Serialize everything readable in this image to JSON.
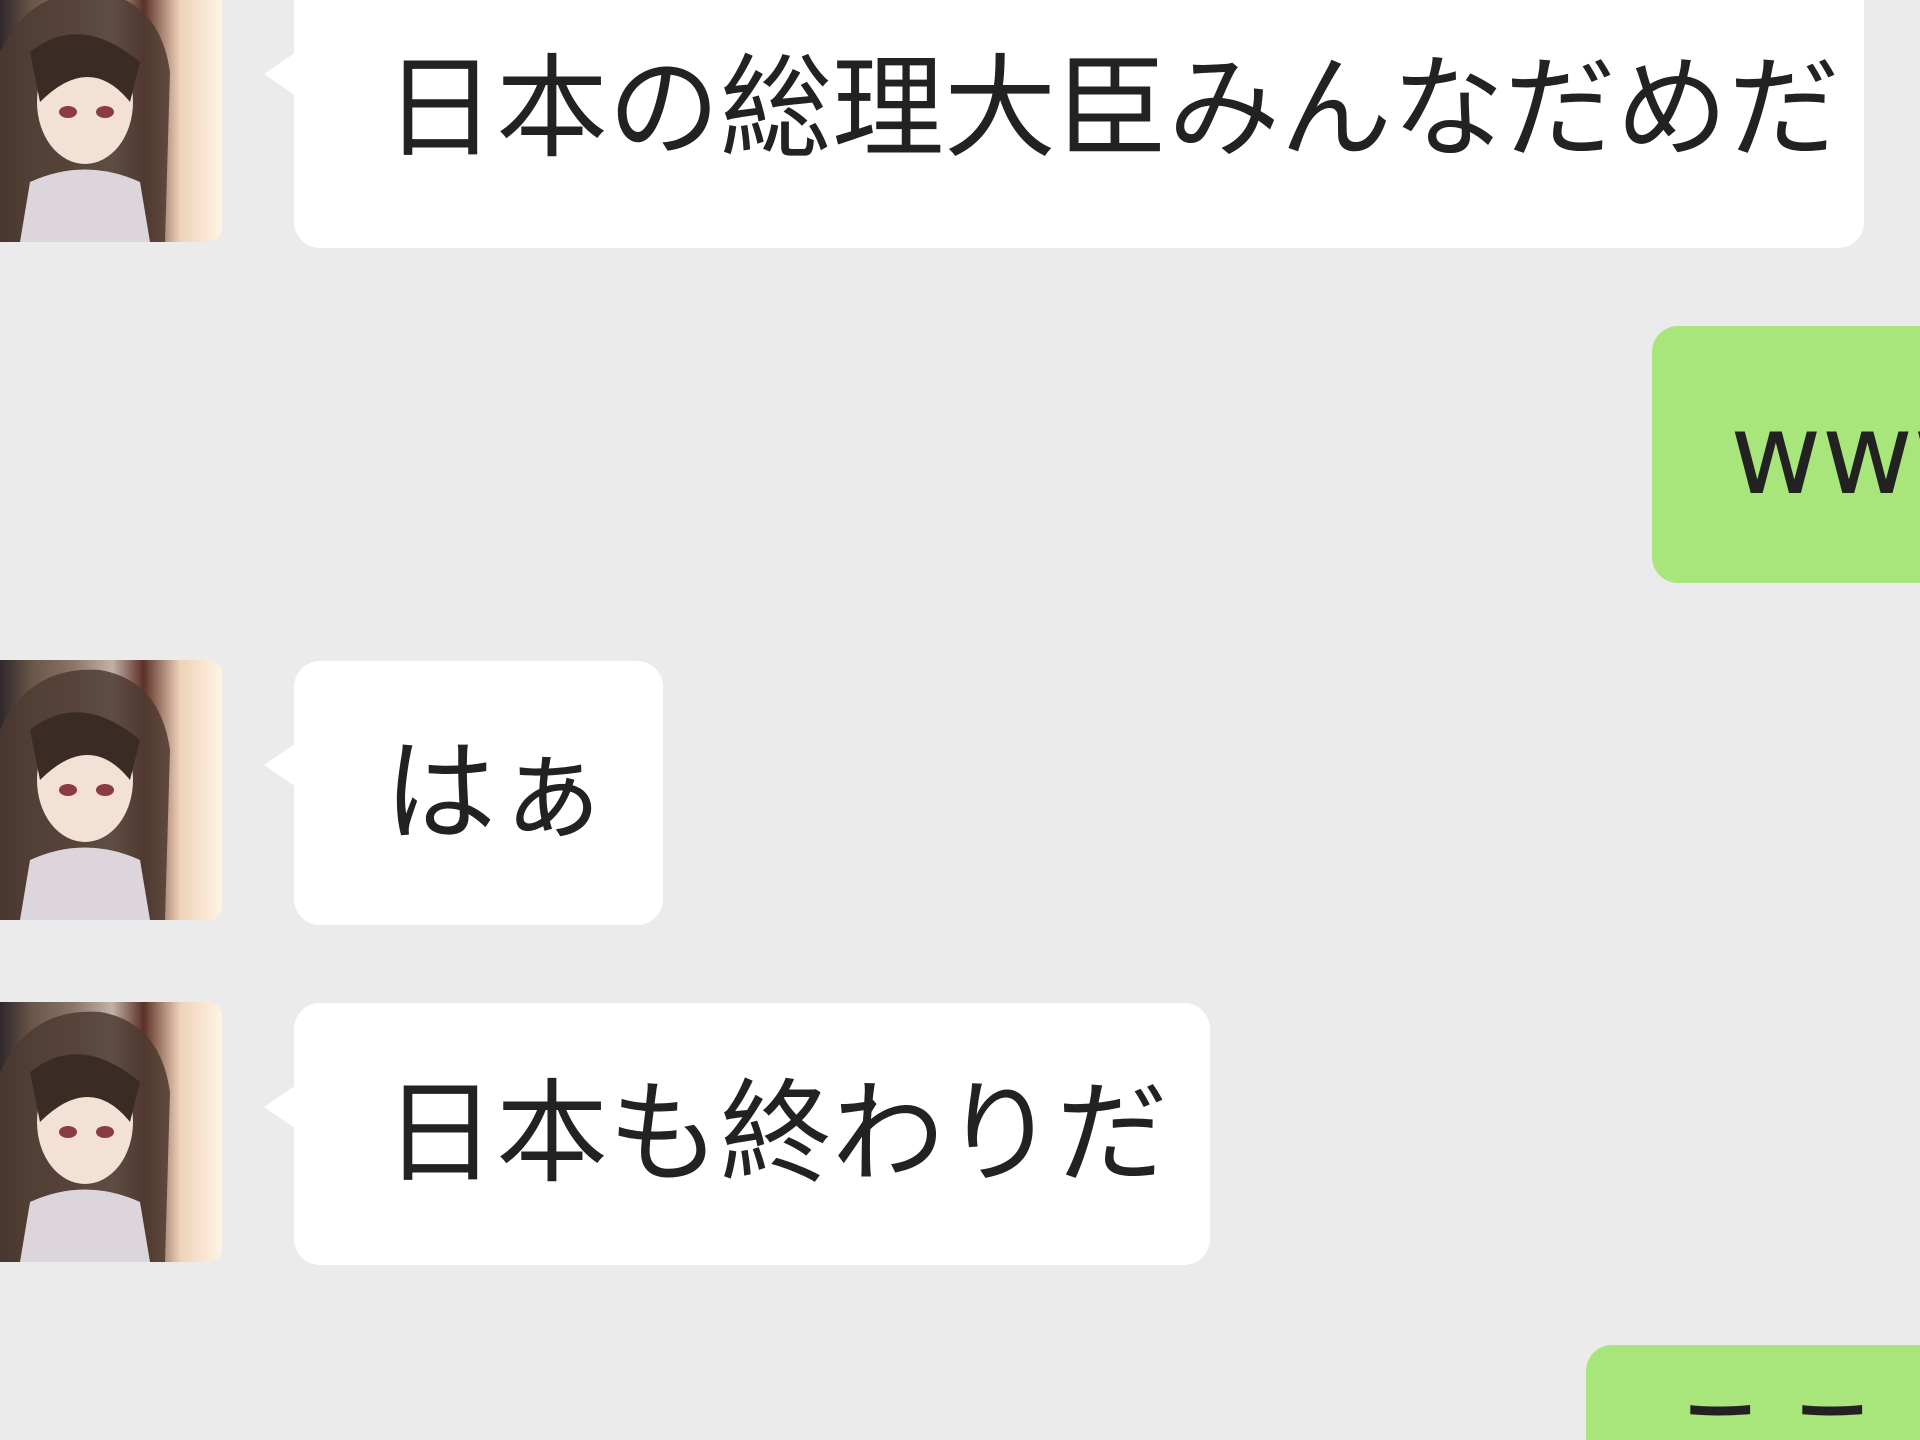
{
  "messages": [
    {
      "side": "incoming",
      "text": "日本の総理大臣みんなだめだ"
    },
    {
      "side": "outgoing",
      "text": "www"
    },
    {
      "side": "incoming",
      "text": "はぁ"
    },
    {
      "side": "incoming",
      "text": "日本も終わりだ"
    },
    {
      "side": "outgoing",
      "text": "ここ"
    }
  ],
  "colors": {
    "background": "#ebebeb",
    "incoming_bubble": "#ffffff",
    "outgoing_bubble": "#a8e57b",
    "text": "#222222"
  },
  "icons": {
    "avatar": "contact-avatar-icon"
  }
}
